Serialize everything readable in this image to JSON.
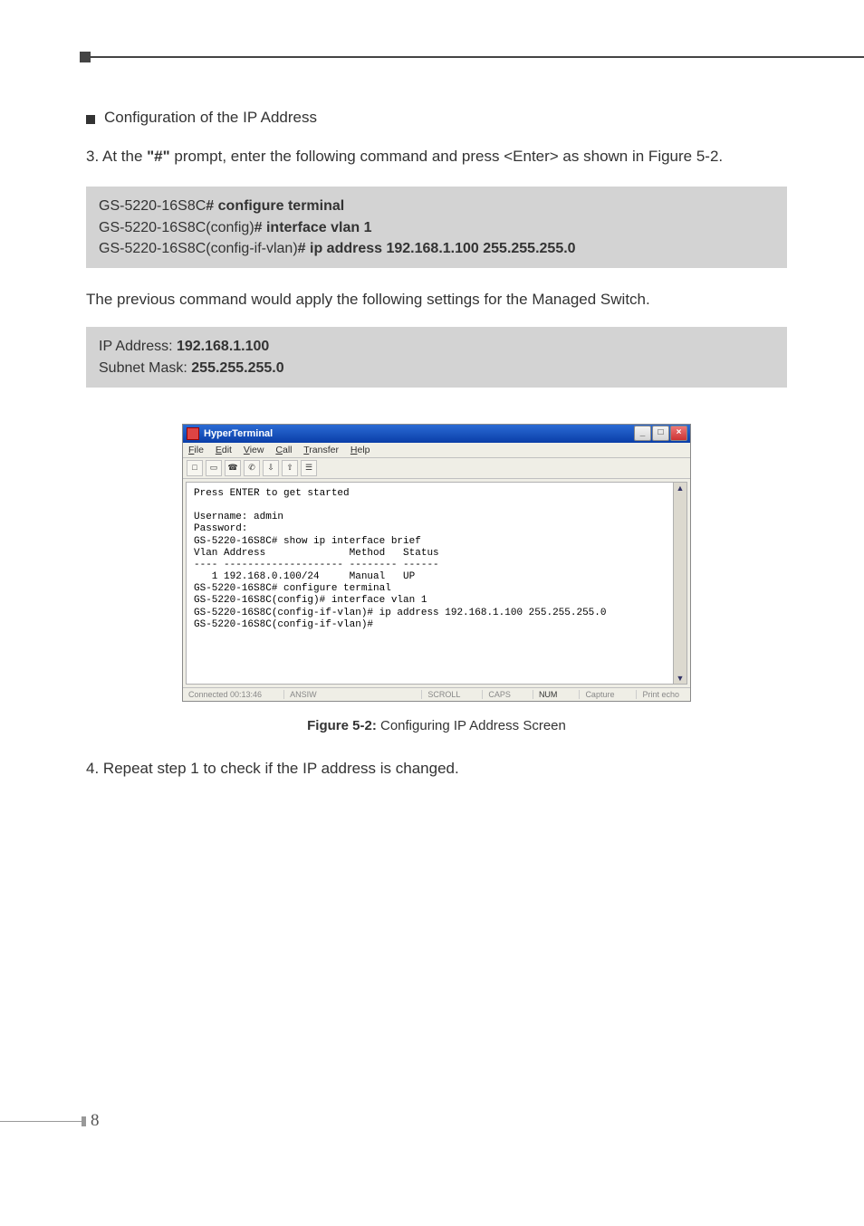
{
  "heading": "Configuration of the IP Address",
  "step3": {
    "num": "3.",
    "text_before": "At the ",
    "prompt_quote": "\"#\"",
    "text_after": " prompt, enter the following command and press <Enter> as shown in Figure 5-2."
  },
  "cmd_box": {
    "l1_host": "GS-5220-16S8C",
    "l1_cmd": "# configure terminal",
    "l2_host": "GS-5220-16S8C(config)",
    "l2_cmd": "# interface vlan 1",
    "l3_host": "GS-5220-16S8C(config-if-vlan)",
    "l3_cmd": "# ip address 192.168.1.100 255.255.255.0"
  },
  "plain1": "The previous command would apply the following settings for the Managed Switch.",
  "settings_box": {
    "ip_label": "IP Address: ",
    "ip_value": "192.168.1.100",
    "mask_label": "Subnet Mask: ",
    "mask_value": "255.255.255.0"
  },
  "hyperterminal": {
    "title": "HyperTerminal",
    "menus": [
      "File",
      "Edit",
      "View",
      "Call",
      "Transfer",
      "Help"
    ],
    "term_text": "Press ENTER to get started\n\nUsername: admin\nPassword:\nGS-5220-16S8C# show ip interface brief\nVlan Address              Method   Status\n---- -------------------- -------- ------\n   1 192.168.0.100/24     Manual   UP\nGS-5220-16S8C# configure terminal\nGS-5220-16S8C(config)# interface vlan 1\nGS-5220-16S8C(config-if-vlan)# ip address 192.168.1.100 255.255.255.0\nGS-5220-16S8C(config-if-vlan)#",
    "status": {
      "connected": "Connected 00:13:46",
      "term_type": "ANSIW",
      "scroll": "SCROLL",
      "caps": "CAPS",
      "num": "NUM",
      "capture": "Capture",
      "print_echo": "Print echo"
    }
  },
  "fig_caption": {
    "bold": "Figure 5-2:",
    "rest": "  Configuring IP Address Screen"
  },
  "step4": {
    "num": "4.",
    "text": " Repeat step 1 to check if the IP address is changed."
  },
  "page_number": "8"
}
